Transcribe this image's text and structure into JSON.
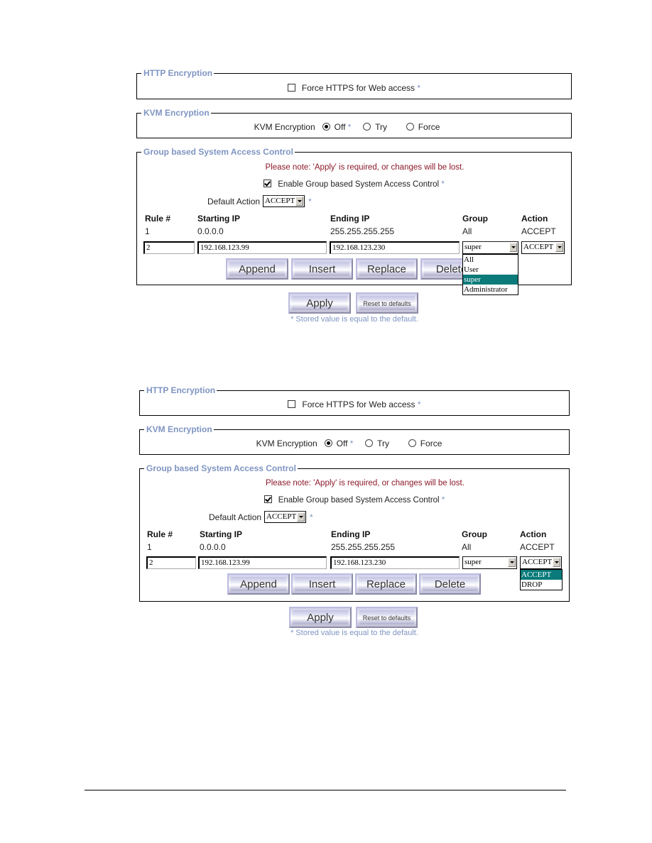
{
  "screens": [
    {
      "http": {
        "legend": "HTTP Encryption",
        "force_https_label": "Force HTTPS for Web access",
        "force_https_checked": false,
        "star": "*"
      },
      "kvm": {
        "legend": "KVM Encryption",
        "label": "KVM Encryption",
        "options": [
          "Off",
          "Try",
          "Force"
        ],
        "selected": "Off",
        "star": "*"
      },
      "gsac": {
        "legend": "Group based System Access Control",
        "note": "Please note: 'Apply' is required, or changes will be lost.",
        "enable_label": "Enable Group based System Access Control",
        "enable_checked": true,
        "default_action_label": "Default Action",
        "default_action_value": "ACCEPT",
        "star": "*",
        "columns": [
          "Rule #",
          "Starting IP",
          "Ending IP",
          "Group",
          "Action"
        ],
        "rows": [
          {
            "rule": "1",
            "start": "0.0.0.0",
            "end": "255.255.255.255",
            "group": "All",
            "action": "ACCEPT"
          }
        ],
        "edit": {
          "rule": "2",
          "start": "192.168.123.99",
          "end": "192.168.123.230",
          "group": "super",
          "action": "ACCEPT"
        },
        "buttons": {
          "append": "Append",
          "insert": "Insert",
          "replace": "Replace",
          "delete": "Delete"
        },
        "open_dropdown": {
          "field": "group",
          "options": [
            "All",
            "User",
            "super",
            "Administrator"
          ],
          "highlighted": "super"
        }
      },
      "apply_label": "Apply",
      "reset_label": "Reset to defaults",
      "footnote": "* Stored value is equal to the default."
    },
    {
      "http": {
        "legend": "HTTP Encryption",
        "force_https_label": "Force HTTPS for Web access",
        "force_https_checked": false,
        "star": "*"
      },
      "kvm": {
        "legend": "KVM Encryption",
        "label": "KVM Encryption",
        "options": [
          "Off",
          "Try",
          "Force"
        ],
        "selected": "Off",
        "star": "*"
      },
      "gsac": {
        "legend": "Group based System Access Control",
        "note": "Please note: 'Apply' is required, or changes will be lost.",
        "enable_label": "Enable Group based System Access Control",
        "enable_checked": true,
        "default_action_label": "Default Action",
        "default_action_value": "ACCEPT",
        "star": "*",
        "columns": [
          "Rule #",
          "Starting IP",
          "Ending IP",
          "Group",
          "Action"
        ],
        "rows": [
          {
            "rule": "1",
            "start": "0.0.0.0",
            "end": "255.255.255.255",
            "group": "All",
            "action": "ACCEPT"
          }
        ],
        "edit": {
          "rule": "2",
          "start": "192.168.123.99",
          "end": "192.168.123.230",
          "group": "super",
          "action": "ACCEPT"
        },
        "buttons": {
          "append": "Append",
          "insert": "Insert",
          "replace": "Replace",
          "delete": "Delete"
        },
        "open_dropdown": {
          "field": "action",
          "options": [
            "ACCEPT",
            "DROP"
          ],
          "highlighted": "ACCEPT"
        }
      },
      "apply_label": "Apply",
      "reset_label": "Reset to defaults",
      "footnote": "* Stored value is equal to the default."
    }
  ],
  "colors": {
    "legend": "#7f95c2",
    "note": "#8b1a2a",
    "highlight": "#0a7a7a"
  }
}
